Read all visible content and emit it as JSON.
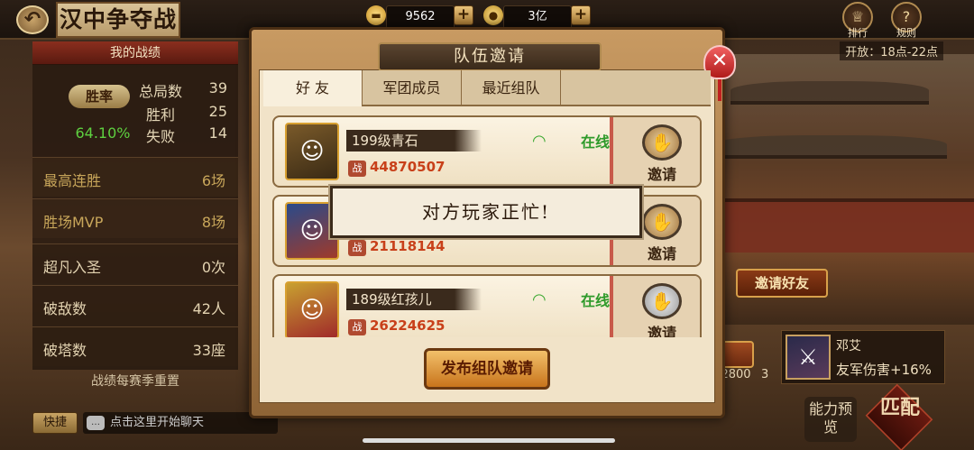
{
  "topbar": {
    "title": "汉中争夺战",
    "ingot": "9562",
    "coins": "3亿",
    "rank_label": "排行",
    "rules_label": "规则",
    "open_time": "开放：18点-22点"
  },
  "record": {
    "header": "我的战绩",
    "win_rate_label": "胜率",
    "win_rate": "64.10%",
    "total_label": "总局数",
    "total": "39",
    "wins_label": "胜利",
    "wins": "25",
    "losses_label": "失败",
    "losses": "14",
    "rows": [
      {
        "label": "最高连胜",
        "value": "6场"
      },
      {
        "label": "胜场MVP",
        "value": "8场"
      },
      {
        "label": "超凡入圣",
        "value": "0次"
      },
      {
        "label": "破敌数",
        "value": "42人"
      },
      {
        "label": "破塔数",
        "value": "33座"
      }
    ],
    "season_note": "战绩每赛季重置"
  },
  "chat": {
    "quick_label": "快捷",
    "placeholder": "点击这里开始聊天"
  },
  "modal": {
    "title": "队伍邀请",
    "tabs": [
      "好 友",
      "军团成员",
      "最近组队"
    ],
    "friends": [
      {
        "name": "199级青石",
        "power": "44870507",
        "status": "在线",
        "invite": "邀请"
      },
      {
        "name": "",
        "power": "21118144",
        "status": "",
        "invite": "邀请"
      },
      {
        "name": "189级红孩儿",
        "power": "26224625",
        "status": "在线",
        "invite": "邀请"
      }
    ],
    "power_badge": "战",
    "toast": "对方玩家正忙!",
    "publish_button": "发布组队邀请"
  },
  "right": {
    "invite_friend_button": "邀请好友",
    "chest_value": "2800",
    "chest_value2": "3",
    "hero_name": "邓艾",
    "hero_buff": "友军伤害+16%",
    "ability_preview": "能力预览",
    "match_button": "匹配"
  },
  "colors": {
    "online": "#2e9a2a",
    "power": "#c8401a",
    "win_rate": "#5ed040"
  }
}
